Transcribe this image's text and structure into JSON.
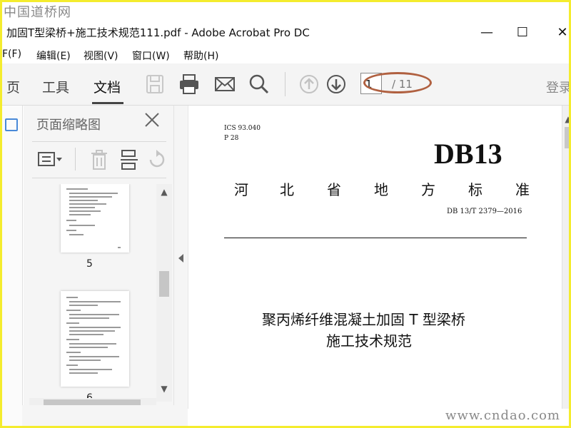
{
  "watermark": {
    "top": "中国道桥网",
    "bottom": "www.cndao.com"
  },
  "window": {
    "title": "加固T型梁桥+施工技术规范111.pdf - Adobe Acrobat Pro DC",
    "controls": {
      "minimize": "—",
      "maximize": "☐",
      "close": "✕"
    }
  },
  "menu": {
    "items": [
      "F(F)",
      "编辑(E)",
      "视图(V)",
      "窗口(W)",
      "帮助(H)"
    ]
  },
  "toolbar": {
    "tabs": [
      "页",
      "工具",
      "文档"
    ],
    "active_tab": "文档",
    "icons": [
      "save-icon",
      "print-icon",
      "mail-icon",
      "search-icon",
      "page-up-icon",
      "page-down-icon"
    ],
    "page_current": "1",
    "page_total": "/ 11",
    "login": "登录"
  },
  "thumbnail_panel": {
    "title": "页面缩略图",
    "tools": [
      "options-icon",
      "trash-icon",
      "insert-icon",
      "undo-icon"
    ],
    "pages": [
      {
        "number": "5"
      },
      {
        "number": "6"
      }
    ]
  },
  "document": {
    "ics": "ICS 93.040",
    "p_code": "P 28",
    "logo": "DB13",
    "province_title": [
      "河",
      "北",
      "省",
      "地",
      "方",
      "标",
      "准"
    ],
    "standard_no": "DB 13/T 2379—2016",
    "title_line1": "聚丙烯纤维混凝土加固 T 型梁桥",
    "title_line2": "施工技术规范"
  },
  "colors": {
    "frame": "#f4ec2e",
    "annotation": "#b06040",
    "toolbar_bg": "#f4f4f4",
    "panel_bg": "#f5f5f5"
  }
}
